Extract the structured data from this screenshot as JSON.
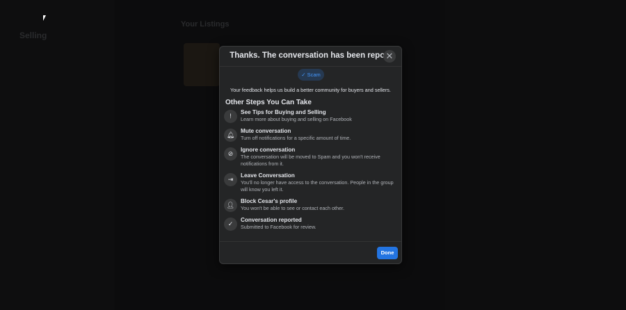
{
  "background": {
    "sidebar_title": "Selling",
    "main_title": "Your Listings"
  },
  "modal": {
    "title": "Thanks. The conversation has been repo...",
    "selected_reason": "Scam",
    "feedback": "Your feedback helps us build a better community for buyers and sellers.",
    "steps_heading": "Other Steps You Can Take",
    "steps": [
      {
        "icon": "info-icon",
        "glyph": "!",
        "title": "See Tips for Buying and Selling",
        "desc": "Learn more about buying and selling on Facebook"
      },
      {
        "icon": "bell-icon",
        "glyph": "🔔︎",
        "title": "Mute conversation",
        "desc": "Turn off notifications for a specific amount of time."
      },
      {
        "icon": "ignore-chat-icon",
        "glyph": "⊘",
        "title": "Ignore conversation",
        "desc": "The conversation will be moved to Spam and you won't receive notifications from it."
      },
      {
        "icon": "leave-icon",
        "glyph": "⇥",
        "title": "Leave Conversation",
        "desc": "You'll no longer have access to the conversation. People in the group will know you left it."
      },
      {
        "icon": "block-user-icon",
        "glyph": "👤︎",
        "title": "Block Cesar's profile",
        "desc": "You won't be able to see or contact each other."
      },
      {
        "icon": "check-icon",
        "glyph": "✓",
        "title": "Conversation reported",
        "desc": "Submitted to Facebook for review."
      }
    ],
    "done_label": "Done"
  }
}
